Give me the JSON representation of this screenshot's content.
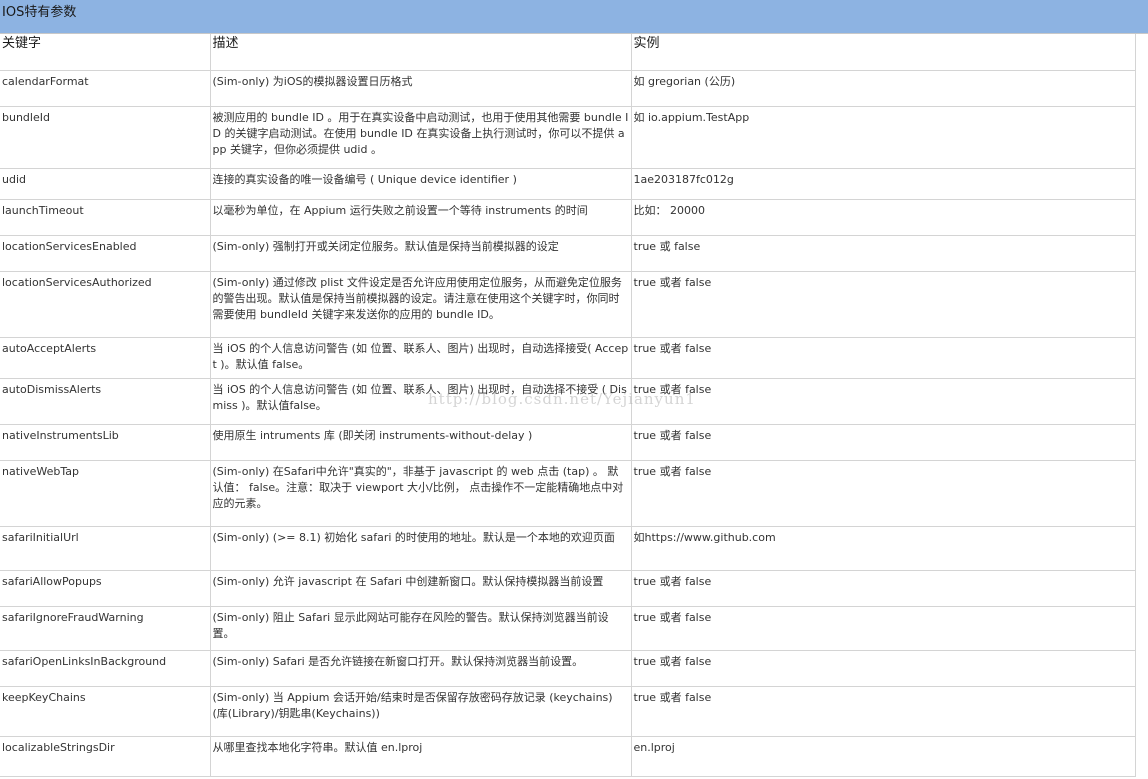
{
  "title": "IOS特有参数",
  "columns": [
    "关键字",
    "描述",
    "实例"
  ],
  "rows": [
    {
      "key": "calendarFormat",
      "desc": "(Sim-only) 为iOS的模拟器设置日历格式",
      "example": "如 gregorian (公历)"
    },
    {
      "key": "bundleId",
      "desc": "被测应用的 bundle ID 。用于在真实设备中启动测试，也用于使用其他需要 bundle ID 的关键字启动测试。在使用 bundle ID 在真实设备上执行测试时，你可以不提供 app 关键字，但你必须提供 udid 。",
      "example": "如 io.appium.TestApp"
    },
    {
      "key": "udid",
      "desc": "连接的真实设备的唯一设备编号 ( Unique device identifier )",
      "example": " 1ae203187fc012g"
    },
    {
      "key": "launchTimeout",
      "desc": "以毫秒为单位，在 Appium 运行失败之前设置一个等待 instruments 的时间",
      "example": "比如： 20000"
    },
    {
      "key": "locationServicesEnabled",
      "desc": "(Sim-only) 强制打开或关闭定位服务。默认值是保持当前模拟器的设定",
      "example": "true 或 false"
    },
    {
      "key": "locationServicesAuthorized",
      "desc": "(Sim-only) 通过修改 plist 文件设定是否允许应用使用定位服务，从而避免定位服务的警告出现。默认值是保持当前模拟器的设定。请注意在使用这个关键字时，你同时需要使用 bundleId 关键字来发送你的应用的 bundle ID。",
      "example": "true 或者 false"
    },
    {
      "key": "autoAcceptAlerts",
      "desc": "当 iOS 的个人信息访问警告 (如 位置、联系人、图片) 出现时，自动选择接受( Accept )。默认值 false。",
      "example": "true 或者 false"
    },
    {
      "key": "autoDismissAlerts",
      "desc": "当 iOS 的个人信息访问警告 (如 位置、联系人、图片) 出现时，自动选择不接受 ( Dismiss )。默认值false。",
      "example": "true 或者 false"
    },
    {
      "key": "nativeInstrumentsLib",
      "desc": "使用原生 intruments 库 (即关闭 instruments-without-delay )",
      "example": "true 或者 false"
    },
    {
      "key": "nativeWebTap",
      "desc": "(Sim-only) 在Safari中允许\"真实的\"，非基于 javascript 的 web 点击 (tap) 。 默认值： false。注意：取决于 viewport 大小/比例， 点击操作不一定能精确地点中对应的元素。",
      "example": "true 或者 false"
    },
    {
      "key": "safariInitialUrl",
      "desc": "(Sim-only) (>= 8.1) 初始化 safari 的时使用的地址。默认是一个本地的欢迎页面",
      "example": "如https://www.github.com"
    },
    {
      "key": "safariAllowPopups",
      "desc": "(Sim-only) 允许 javascript 在 Safari 中创建新窗口。默认保持模拟器当前设置",
      "example": "true 或者 false"
    },
    {
      "key": "safariIgnoreFraudWarning",
      "desc": "(Sim-only) 阻止 Safari 显示此网站可能存在风险的警告。默认保持浏览器当前设置。",
      "example": "true 或者 false"
    },
    {
      "key": "safariOpenLinksInBackground",
      "desc": "(Sim-only) Safari 是否允许链接在新窗口打开。默认保持浏览器当前设置。",
      "example": "true 或者 false"
    },
    {
      "key": "keepKeyChains",
      "desc": "(Sim-only) 当 Appium 会话开始/结束时是否保留存放密码存放记录 (keychains) (库(Library)/钥匙串(Keychains))",
      "example": "true 或者 false"
    },
    {
      "key": "localizableStringsDir",
      "desc": "从哪里查找本地化字符串。默认值 en.lproj",
      "example": "en.lproj"
    }
  ],
  "watermark": "http://blog.csdn.net/Yejianyun1"
}
